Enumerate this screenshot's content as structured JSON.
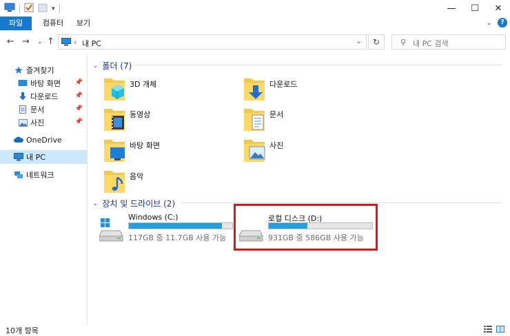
{
  "window": {
    "minimize": "—",
    "maximize": "☐",
    "close": "✕"
  },
  "ribbon": {
    "tabs": [
      "파일",
      "컴퓨터",
      "보기"
    ],
    "help": "?"
  },
  "address": {
    "crumb": "내 PC",
    "search_placeholder": "내 PC 검색"
  },
  "sidebar": {
    "items": [
      {
        "label": "즐겨찾기",
        "icon": "star-icon"
      },
      {
        "label": "바탕 화면",
        "icon": "desktop-icon",
        "pinned": true
      },
      {
        "label": "다운로드",
        "icon": "download-icon",
        "pinned": true
      },
      {
        "label": "문서",
        "icon": "document-icon",
        "pinned": true
      },
      {
        "label": "사진",
        "icon": "pictures-icon",
        "pinned": true
      },
      {
        "label": "OneDrive",
        "icon": "cloud-icon"
      },
      {
        "label": "내 PC",
        "icon": "pc-icon",
        "selected": true
      },
      {
        "label": "네트워크",
        "icon": "network-icon"
      }
    ]
  },
  "folders_group": {
    "header": "폴더 (7)",
    "items": [
      {
        "name": "3D 개체",
        "icon": "3d-objects-folder-icon"
      },
      {
        "name": "다운로드",
        "icon": "downloads-folder-icon"
      },
      {
        "name": "동영상",
        "icon": "videos-folder-icon"
      },
      {
        "name": "문서",
        "icon": "documents-folder-icon"
      },
      {
        "name": "바탕 화면",
        "icon": "desktop-folder-icon"
      },
      {
        "name": "사진",
        "icon": "pictures-folder-icon"
      },
      {
        "name": "음악",
        "icon": "music-folder-icon"
      }
    ]
  },
  "drives_group": {
    "header": "장치 및 드라이브 (2)",
    "items": [
      {
        "name": "Windows (C:)",
        "info": "117GB 중 11.7GB 사용 가능",
        "used_fraction": 0.9
      },
      {
        "name": "로컬 디스크 (D:)",
        "info": "931GB 중 586GB 사용 가능",
        "used_fraction": 0.37
      }
    ]
  },
  "status": {
    "count": "10개 항목"
  },
  "colors": {
    "accent": "#1979ca",
    "bar_fill": "#26a0da",
    "highlight": "#e0141e",
    "group_header": "#1e3287"
  }
}
